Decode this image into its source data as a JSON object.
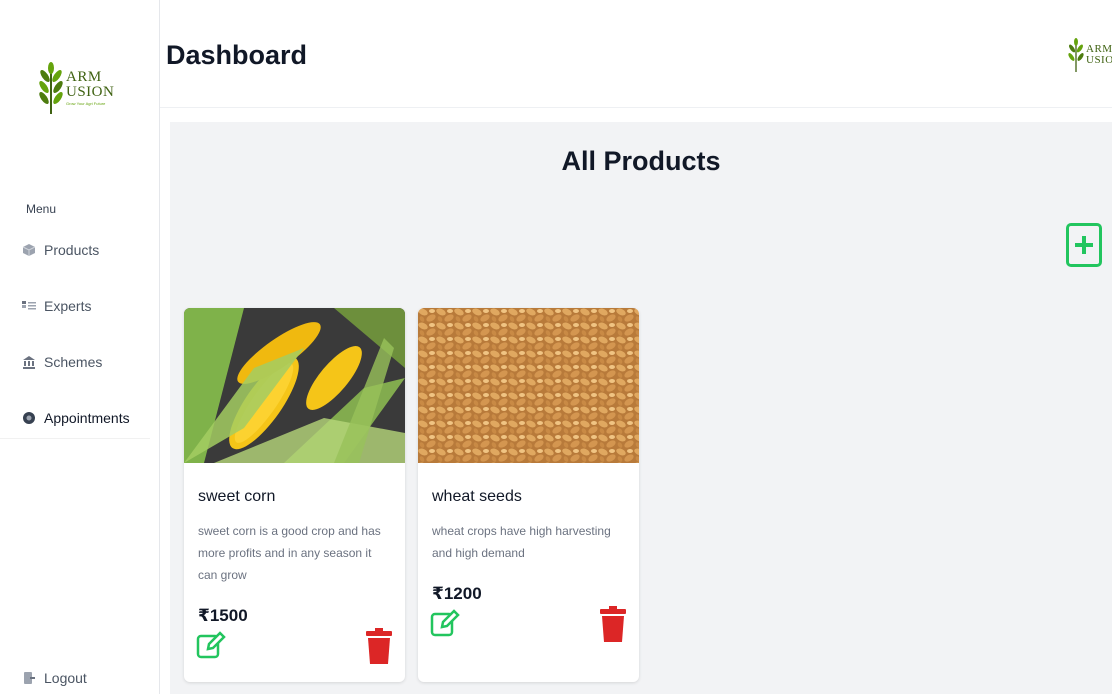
{
  "brand": {
    "line1": "ARM",
    "line2": "USION",
    "tagline": "Grow Your Agri Future"
  },
  "sidebar": {
    "menu_label": "Menu",
    "items": [
      {
        "label": "Products",
        "icon": "package-icon"
      },
      {
        "label": "Experts",
        "icon": "experts-icon"
      },
      {
        "label": "Schemes",
        "icon": "schemes-icon"
      },
      {
        "label": "Appointments",
        "icon": "appointments-icon"
      }
    ],
    "logout_label": "Logout"
  },
  "header": {
    "title": "Dashboard"
  },
  "main": {
    "title": "All Products"
  },
  "products": [
    {
      "name": "sweet corn",
      "description": "sweet corn is a good crop and has more profits and in any season it can grow",
      "price": "₹1500",
      "image": "corn"
    },
    {
      "name": "wheat seeds",
      "description": "wheat crops have high harvesting and high demand",
      "price": "₹1200",
      "image": "wheat"
    }
  ],
  "colors": {
    "accent": "#22c55e",
    "danger": "#dc2626",
    "panel_bg": "#f2f3f5"
  }
}
